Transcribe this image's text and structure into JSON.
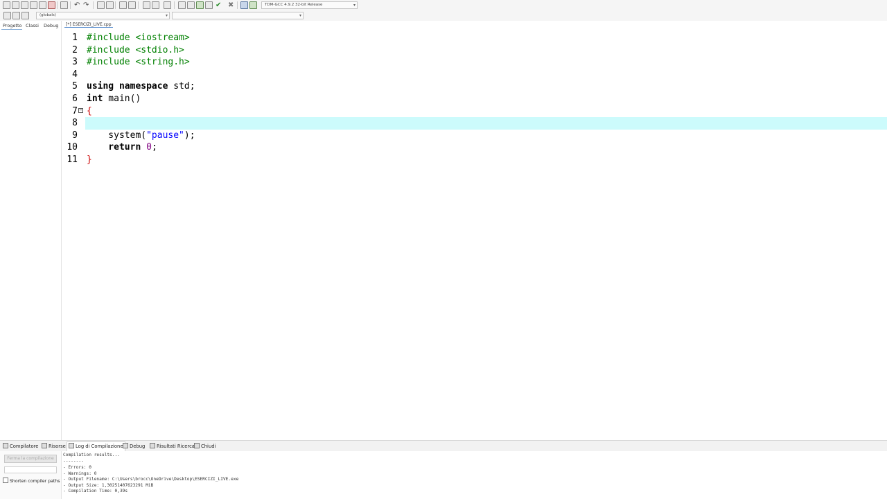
{
  "toolbar": {
    "compiler_select": "TDM-GCC 4.9.2 32-bit Release",
    "scope_select": "(globals)",
    "symbol_select": ""
  },
  "left_panel": {
    "tabs": [
      "Progetto",
      "Classi",
      "Debug"
    ]
  },
  "editor": {
    "tab_title": "[*] ESERCIZI_LIVE.cpp",
    "line_numbers": [
      "1",
      "2",
      "3",
      "4",
      "5",
      "6",
      "7",
      "8",
      "9",
      "10",
      "11"
    ],
    "lines": {
      "l1": "#include <iostream>",
      "l2": "#include <stdio.h>",
      "l3": "#include <string.h>",
      "l5_kw1": "using",
      "l5_kw2": "namespace",
      "l5_rest": " std;",
      "l6_kw": "int",
      "l6_rest": " main()",
      "l7": "{",
      "l9_a": "    system(",
      "l9_str": "\"pause\"",
      "l9_b": ");",
      "l10_kw": "    return",
      "l10_num": " 0",
      "l10_end": ";",
      "l11": "}"
    }
  },
  "bottom_tabs": [
    "Compilatore",
    "Risorse",
    "Log di Compilazione",
    "Debug",
    "Risultati Ricerca",
    "Chiudi"
  ],
  "bottom_left": {
    "abort_label": "Ferma la compilazione",
    "shorten_label": "Shorten compiler paths"
  },
  "log_lines": [
    "Compilation results...",
    "--------",
    "- Errors: 0",
    "- Warnings: 0",
    "- Output Filename: C:\\Users\\brocc\\OneDrive\\Desktop\\ESERCIZI_LIVE.exe",
    "- Output Size: 1,30251407623291 MiB",
    "- Compilation Time: 0,39s"
  ]
}
